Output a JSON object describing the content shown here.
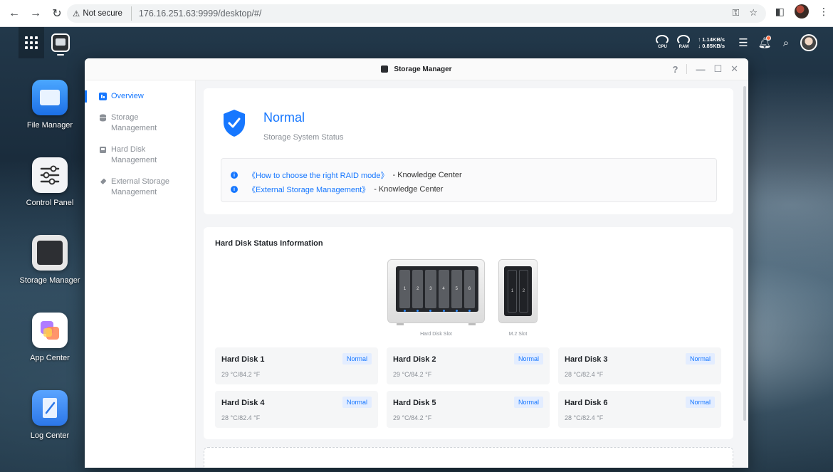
{
  "browser": {
    "security_label": "Not secure",
    "url": "176.16.251.63:9999/desktop/#/"
  },
  "tray": {
    "cpu_label": "CPU",
    "ram_label": "RAM",
    "upload": "↑ 1.14KB/s",
    "download": "↓ 0.85KB/s"
  },
  "dock": [
    {
      "label": "File Manager"
    },
    {
      "label": "Control Panel"
    },
    {
      "label": "Storage Manager"
    },
    {
      "label": "App Center"
    },
    {
      "label": "Log Center"
    }
  ],
  "window": {
    "title": "Storage Manager",
    "help": "?",
    "minimize": "—",
    "maximize": "☐",
    "close": "✕"
  },
  "sidebar": {
    "items": [
      {
        "label": "Overview",
        "active": true
      },
      {
        "label": "Storage Management",
        "active": false
      },
      {
        "label": "Hard Disk Management",
        "active": false
      },
      {
        "label": "External Storage Management",
        "active": false
      }
    ]
  },
  "status": {
    "title": "Normal",
    "subtitle": "Storage System Status",
    "links": [
      {
        "text": "《How to choose the right RAID mode》",
        "suffix": "- Knowledge Center"
      },
      {
        "text": "《External Storage Management》",
        "suffix": "- Knowledge Center"
      }
    ]
  },
  "hard_disk": {
    "section_title": "Hard Disk Status Information",
    "nas_bays": [
      "1",
      "2",
      "3",
      "4",
      "5",
      "6"
    ],
    "nas_label": "Hard Disk Slot",
    "m2_slots": [
      "1",
      "2"
    ],
    "m2_label": "M.2 Slot",
    "disks": [
      {
        "name": "Hard Disk 1",
        "temp": "29 °C/84.2 °F",
        "status": "Normal"
      },
      {
        "name": "Hard Disk 2",
        "temp": "29 °C/84.2 °F",
        "status": "Normal"
      },
      {
        "name": "Hard Disk 3",
        "temp": "28 °C/82.4 °F",
        "status": "Normal"
      },
      {
        "name": "Hard Disk 4",
        "temp": "28 °C/82.4 °F",
        "status": "Normal"
      },
      {
        "name": "Hard Disk 5",
        "temp": "29 °C/84.2 °F",
        "status": "Normal"
      },
      {
        "name": "Hard Disk 6",
        "temp": "28 °C/82.4 °F",
        "status": "Normal"
      }
    ]
  },
  "colors": {
    "accent": "#1677ff",
    "badge_bg": "#e3edff"
  }
}
